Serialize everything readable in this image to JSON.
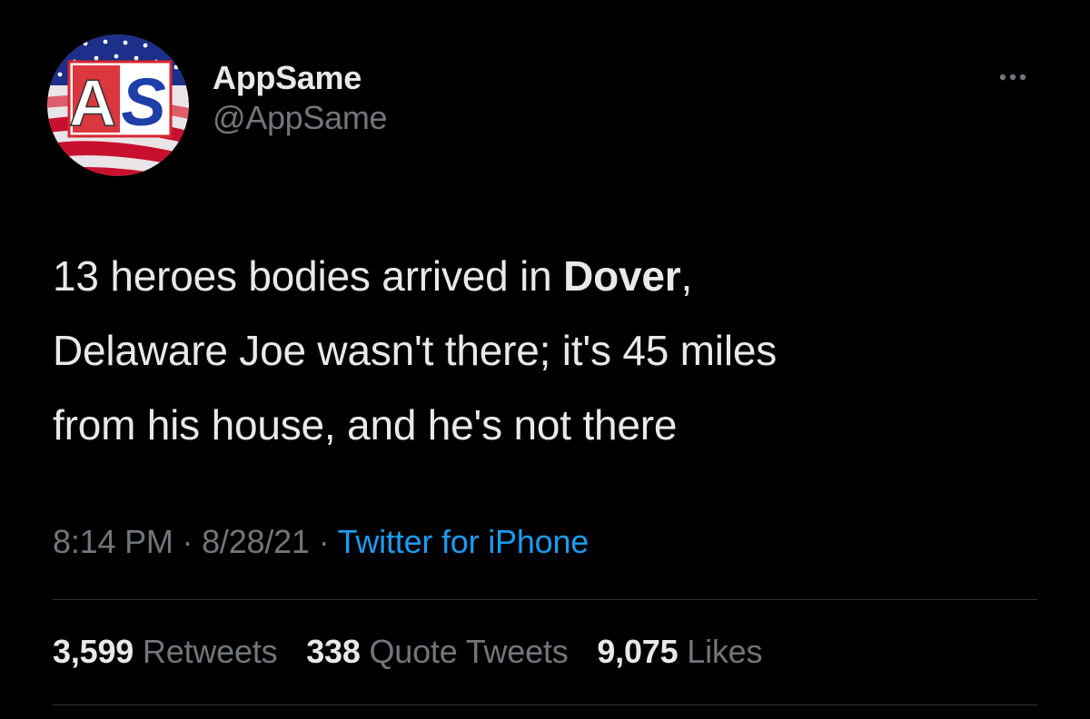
{
  "author": {
    "display_name": "AppSame",
    "handle": "@AppSame",
    "avatar_text": "AS",
    "avatar_colors": {
      "flag_red": "#c8102e",
      "flag_blue": "#1c2f8a",
      "letter_red": "#d7262e",
      "letter_blue": "#1f3fa8"
    }
  },
  "tweet": {
    "lines": [
      {
        "before": "13 heroes bodies arrived in ",
        "bold": "Dover",
        "after": ","
      },
      {
        "text": "Delaware Joe wasn't there; it's 45 miles"
      },
      {
        "text": "from his house, and he's not there"
      }
    ],
    "time": "8:14 PM",
    "sep1": "·",
    "date": "8/28/21",
    "sep2": "·",
    "source": "Twitter for iPhone"
  },
  "stats": {
    "retweets": {
      "count": "3,599",
      "label": "Retweets"
    },
    "quote_tweets": {
      "count": "338",
      "label": "Quote Tweets"
    },
    "likes": {
      "count": "9,075",
      "label": "Likes"
    }
  },
  "icons": {
    "more": "more-horizontal-icon"
  },
  "colors": {
    "background": "#000000",
    "primary_text": "#e7e9ea",
    "secondary_text": "#71767b",
    "link": "#1d9bf0",
    "divider": "#2f3336"
  }
}
